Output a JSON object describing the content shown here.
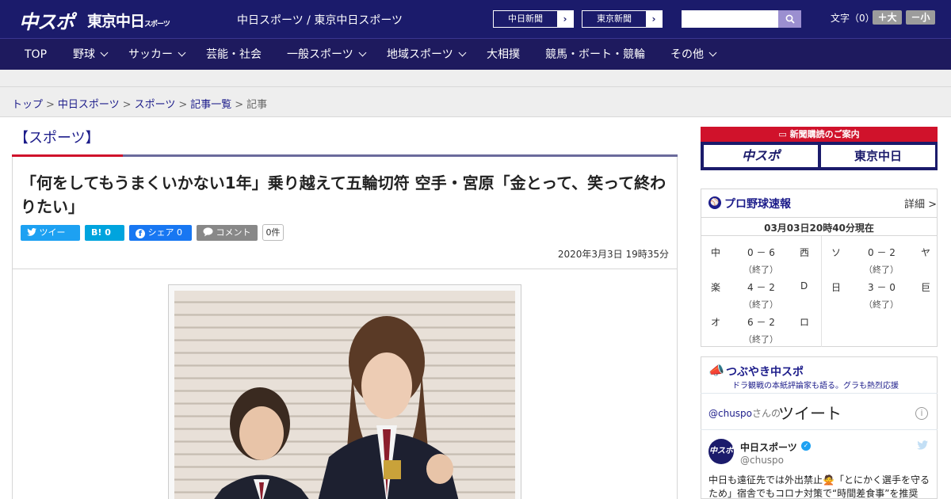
{
  "header": {
    "logo_main": "中スポ",
    "logo_tokyo": "東京中日",
    "logo_tokyo_small": "スポーツ",
    "site_name": "中日スポーツ / 東京中日スポーツ",
    "paper_links": [
      {
        "label": "中日新聞",
        "arrow": "›"
      },
      {
        "label": "東京新聞",
        "arrow": "›"
      }
    ],
    "search": {
      "placeholder": "",
      "icon": "search-icon"
    },
    "font_size": {
      "label": "文字（0）",
      "larger": "＋大",
      "smaller": "－小"
    }
  },
  "nav": {
    "items": [
      {
        "label": "TOP",
        "dropdown": false
      },
      {
        "label": "野球",
        "dropdown": true
      },
      {
        "label": "サッカー",
        "dropdown": true
      },
      {
        "label": "芸能・社会",
        "dropdown": false
      },
      {
        "label": "一般スポーツ",
        "dropdown": true
      },
      {
        "label": "地域スポーツ",
        "dropdown": true
      },
      {
        "label": "大相撲",
        "dropdown": false
      },
      {
        "label": "競馬・ボート・競輪",
        "dropdown": false
      },
      {
        "label": "その他",
        "dropdown": true
      }
    ]
  },
  "breadcrumb": {
    "items": [
      "トップ",
      "中日スポーツ",
      "スポーツ",
      "記事一覧"
    ],
    "current": "記事",
    "separator": ">"
  },
  "article": {
    "section": "【スポーツ】",
    "headline": "「何をしてもうまくいかない1年」乗り越えて五輪切符 空手・宮原「金とって、笑って終わりたい」",
    "share": {
      "tweet": "ツイート",
      "hatena": "B!",
      "hatena_count": "0",
      "facebook": "シェア",
      "facebook_count": "0",
      "comment": "コメント",
      "comment_count": "0件"
    },
    "date": "2020年3月3日 19時35分"
  },
  "sidebar": {
    "subscribe": {
      "title": "新聞購読のご案内",
      "logo_left": "中スポ",
      "logo_right": "東京中日"
    },
    "baseball": {
      "title": "プロ野球速報",
      "detail": "詳細 >",
      "time": "03月03日20時40分現在",
      "games": [
        {
          "home": "中",
          "score": "0 － 6",
          "away": "西",
          "status": "（終了）"
        },
        {
          "home": "ソ",
          "score": "0 － 2",
          "away": "ヤ",
          "status": "（終了）"
        },
        {
          "home": "楽",
          "score": "4 － 2",
          "away": "D",
          "status": "（終了）"
        },
        {
          "home": "日",
          "score": "3 － 0",
          "away": "巨",
          "status": "（終了）"
        },
        {
          "home": "オ",
          "score": "6 － 2",
          "away": "ロ",
          "status": "（終了）"
        }
      ]
    },
    "tweets": {
      "title": "つぶやき中スポ",
      "subtitle": "ドラ観戦の本紙評論家も語る。グラも熱烈応援",
      "handle": "@chuspo",
      "handle_suffix": "さんの",
      "heading": "ツイート",
      "info": "i",
      "tweet": {
        "avatar": "中スポ",
        "name": "中日スポーツ",
        "user": "@chuspo",
        "text": "中日も遠征先では外出禁止🙅「とにかく選手を守るため」宿舎でもコロナ対策で“時間差食事”を推奨"
      }
    }
  },
  "colors": {
    "brand_navy": "#1b1b6b",
    "accent_red": "#d0122b",
    "link_blue": "#1c1c8a"
  }
}
